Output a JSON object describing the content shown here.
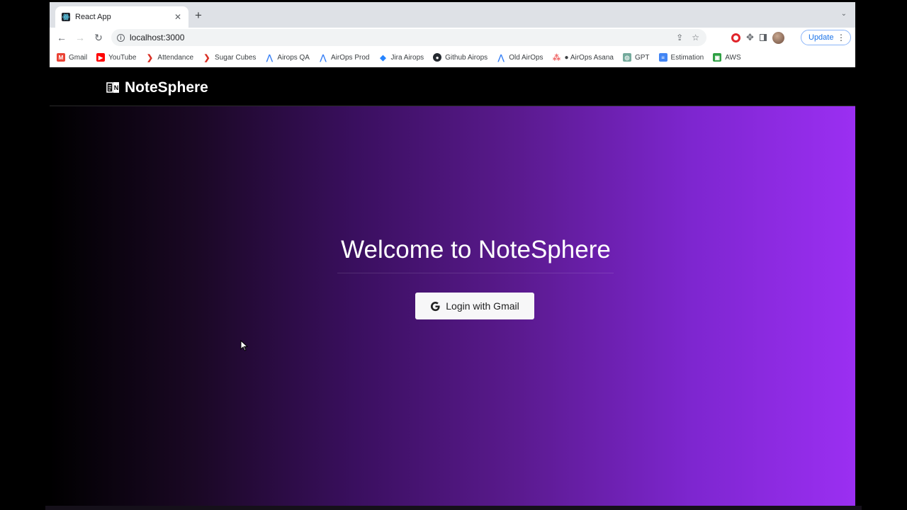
{
  "browser": {
    "tab": {
      "title": "React App"
    },
    "address": {
      "url": "localhost:3000"
    },
    "update_label": "Update",
    "bookmarks": [
      {
        "label": "Gmail",
        "icon": "gmail-icon",
        "color": "#ea4335",
        "glyph": "M"
      },
      {
        "label": "YouTube",
        "icon": "youtube-icon",
        "color": "#ff0000",
        "glyph": "▶"
      },
      {
        "label": "Attendance",
        "icon": "attendance-icon",
        "color": "#d93025",
        "glyph": "❯"
      },
      {
        "label": "Sugar Cubes",
        "icon": "sugar-cubes-icon",
        "color": "#d93025",
        "glyph": "❯"
      },
      {
        "label": "Airops QA",
        "icon": "airops-icon",
        "color": "#3b82f6",
        "glyph": "⋀"
      },
      {
        "label": "AirOps Prod",
        "icon": "airops-icon",
        "color": "#3b82f6",
        "glyph": "⋀"
      },
      {
        "label": "Jira Airops",
        "icon": "jira-icon",
        "color": "#2684ff",
        "glyph": "◆"
      },
      {
        "label": "Github Airops",
        "icon": "github-icon",
        "color": "#24292f",
        "glyph": "●"
      },
      {
        "label": "Old AirOps",
        "icon": "airops-icon",
        "color": "#3b82f6",
        "glyph": "⋀"
      },
      {
        "label": "● AirOps Asana",
        "icon": "asana-icon",
        "color": "#f06a6a",
        "glyph": "⁂"
      },
      {
        "label": "GPT",
        "icon": "gpt-icon",
        "color": "#74aa9c",
        "glyph": "◎"
      },
      {
        "label": "Estimation",
        "icon": "sheets-icon",
        "color": "#4285f4",
        "glyph": "≡"
      },
      {
        "label": "AWS",
        "icon": "aws-icon",
        "color": "#2ea043",
        "glyph": "▣"
      }
    ]
  },
  "app": {
    "brand": "NoteSphere",
    "welcome_title": "Welcome to NoteSphere",
    "login_label": "Login with Gmail",
    "colors": {
      "gradient_start": "#000000",
      "gradient_end": "#9b2ff2",
      "button_bg": "#f7f7f8"
    }
  }
}
